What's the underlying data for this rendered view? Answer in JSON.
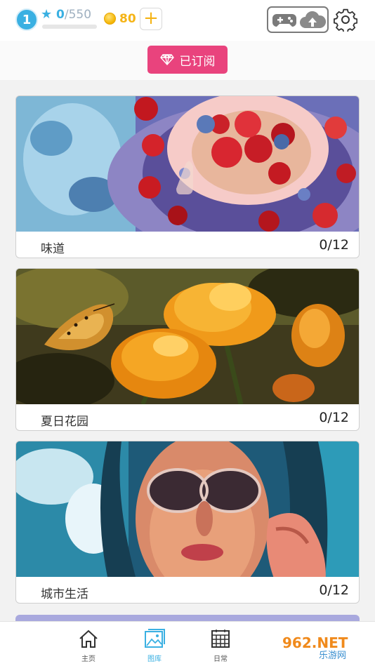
{
  "header": {
    "level": "1",
    "xp_current": "0",
    "xp_total": "/550",
    "xp_progress": 0,
    "coins": "80",
    "add_coins_label": "+"
  },
  "subscription": {
    "label": "已订阅"
  },
  "categories": [
    {
      "name": "味道",
      "progress": "0/12"
    },
    {
      "name": "夏日花园",
      "progress": "0/12"
    },
    {
      "name": "城市生活",
      "progress": "0/12"
    }
  ],
  "bottom_nav": [
    {
      "label": "主页",
      "icon": "home-icon",
      "active": false
    },
    {
      "label": "图库",
      "icon": "gallery-icon",
      "active": true
    },
    {
      "label": "日常",
      "icon": "calendar-icon",
      "active": false
    }
  ],
  "watermark": {
    "text_top": "962.NET",
    "text_bottom": "乐游网"
  },
  "colors": {
    "accent_blue": "#3ab0e2",
    "subscribe_pink": "#e9437d",
    "coin_gold": "#f5b417"
  }
}
